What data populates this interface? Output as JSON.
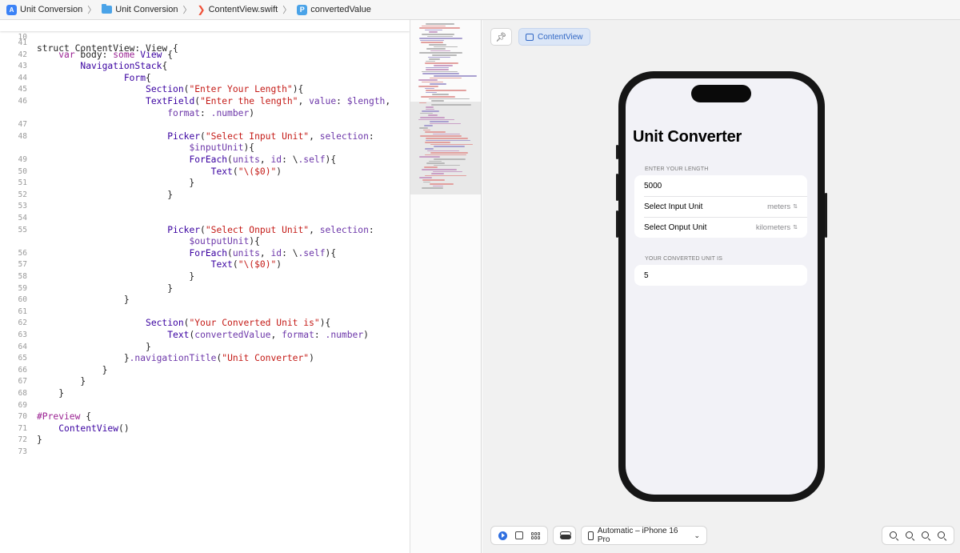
{
  "breadcrumb": {
    "items": [
      {
        "label": "Unit Conversion",
        "icon": "app-icon"
      },
      {
        "label": "Unit Conversion",
        "icon": "folder-icon"
      },
      {
        "label": "ContentView.swift",
        "icon": "swift-icon"
      },
      {
        "label": "convertedValue",
        "icon": "property-icon"
      }
    ],
    "property_badge": "P",
    "app_badge": "A"
  },
  "editor": {
    "sticky_line": {
      "n": "10",
      "text": "struct ContentView: View {"
    },
    "lines": [
      {
        "n": "41",
        "text": ""
      },
      {
        "n": "42",
        "text": "    var body: some View {"
      },
      {
        "n": "43",
        "text": "        NavigationStack{"
      },
      {
        "n": "44",
        "text": "                Form{"
      },
      {
        "n": "45",
        "text": "                    Section(\"Enter Your Length\"){"
      },
      {
        "n": "46",
        "text": "                    TextField(\"Enter the length\", value: $length,"
      },
      {
        "n": "",
        "text": "                        format: .number)"
      },
      {
        "n": "47",
        "text": ""
      },
      {
        "n": "48",
        "text": "                        Picker(\"Select Input Unit\", selection:"
      },
      {
        "n": "",
        "text": "                            $inputUnit){"
      },
      {
        "n": "49",
        "text": "                            ForEach(units, id: \\.self){"
      },
      {
        "n": "50",
        "text": "                                Text(\"\\($0)\")"
      },
      {
        "n": "51",
        "text": "                            }"
      },
      {
        "n": "52",
        "text": "                        }"
      },
      {
        "n": "53",
        "text": ""
      },
      {
        "n": "54",
        "text": ""
      },
      {
        "n": "55",
        "text": "                        Picker(\"Select Onput Unit\", selection:"
      },
      {
        "n": "",
        "text": "                            $outputUnit){"
      },
      {
        "n": "56",
        "text": "                            ForEach(units, id: \\.self){"
      },
      {
        "n": "57",
        "text": "                                Text(\"\\($0)\")"
      },
      {
        "n": "58",
        "text": "                            }"
      },
      {
        "n": "59",
        "text": "                        }"
      },
      {
        "n": "60",
        "text": "                }"
      },
      {
        "n": "61",
        "text": ""
      },
      {
        "n": "62",
        "text": "                    Section(\"Your Converted Unit is\"){"
      },
      {
        "n": "63",
        "text": "                        Text(convertedValue, format: .number)"
      },
      {
        "n": "64",
        "text": "                    }"
      },
      {
        "n": "65",
        "text": "                }.navigationTitle(\"Unit Converter\")"
      },
      {
        "n": "66",
        "text": "            }"
      },
      {
        "n": "67",
        "text": "        }"
      },
      {
        "n": "68",
        "text": "    }"
      },
      {
        "n": "69",
        "text": ""
      },
      {
        "n": "70",
        "text": "#Preview {"
      },
      {
        "n": "71",
        "text": "    ContentView()"
      },
      {
        "n": "72",
        "text": "}"
      },
      {
        "n": "73",
        "text": ""
      }
    ]
  },
  "preview": {
    "pin_icon": "pin-icon",
    "content_view_label": "ContentView",
    "device_label": "Automatic – iPhone 16 Pro",
    "app": {
      "title": "Unit Converter",
      "section1_header": "ENTER YOUR LENGTH",
      "length_value": "5000",
      "input_label": "Select Input Unit",
      "input_value": "meters",
      "output_label": "Select Onput Unit",
      "output_value": "kilometers",
      "section2_header": "YOUR CONVERTED UNIT IS",
      "converted_value": "5"
    }
  },
  "colors": {
    "keyword": "#9b2393",
    "type": "#3900a0",
    "string": "#c41a16",
    "accent": "#2f66c4"
  }
}
